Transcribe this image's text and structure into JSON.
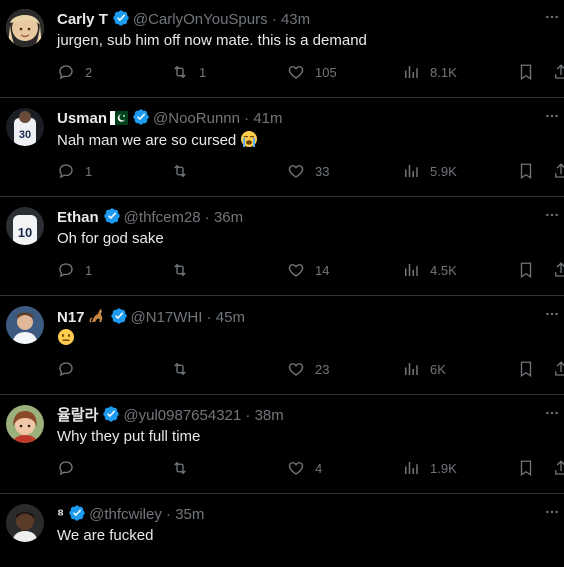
{
  "tweets": [
    {
      "name": "Carly T",
      "handle": "@CarlyOnYouSpurs",
      "sep": "·",
      "time": "43m",
      "text": "jurgen, sub him off now mate. this is a demand",
      "replies": "2",
      "retweets": "1",
      "likes": "105",
      "views": "8.1K",
      "avatar_color": "#c9a27a"
    },
    {
      "name": "Usman",
      "handle": "@NooRunnn",
      "sep": "·",
      "time": "41m",
      "text": "Nah man we are so cursed",
      "replies": "1",
      "retweets": "",
      "likes": "33",
      "views": "5.9K",
      "avatar_color": "#dfe3ea",
      "flag": "pakistan-flag-icon",
      "text_emoji": "loudly-crying-face-icon"
    },
    {
      "name": "Ethan",
      "handle": "@thfcem28",
      "sep": "·",
      "time": "36m",
      "text": "Oh for god sake",
      "replies": "1",
      "retweets": "",
      "likes": "14",
      "views": "4.5K",
      "avatar_color": "#cfd3d8"
    },
    {
      "name": "N17",
      "handle": "@N17WHI",
      "sep": "·",
      "time": "45m",
      "text": "",
      "replies": "",
      "retweets": "",
      "likes": "23",
      "views": "6K",
      "avatar_color": "#5a6e8a",
      "name_emoji": "kangaroo-icon",
      "text_emoji": "neutral-face-icon"
    },
    {
      "name": "율랄라",
      "handle": "@yul0987654321",
      "sep": "·",
      "time": "38m",
      "text": "Why they put full time",
      "replies": "",
      "retweets": "",
      "likes": "4",
      "views": "1.9K",
      "avatar_color": "#b08a6a"
    },
    {
      "name": "⁸",
      "handle": "@thfcwiley",
      "sep": "·",
      "time": "35m",
      "text": "We are fucked",
      "replies": "",
      "retweets": "",
      "likes": "",
      "views": "",
      "avatar_color": "#4a3a30"
    }
  ],
  "colors": {
    "bg": "#000000",
    "text": "#e7e9ea",
    "muted": "#71767b",
    "verified": "#1d9bf0",
    "divider": "#2f3336"
  }
}
